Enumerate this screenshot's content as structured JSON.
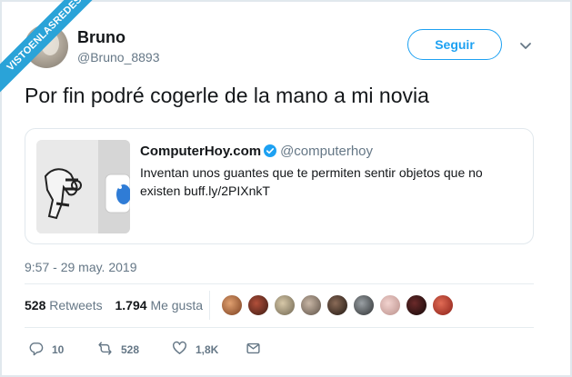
{
  "watermark": {
    "text": "VISTOENLASREDES"
  },
  "author": {
    "name": "Bruno",
    "handle": "@Bruno_8893"
  },
  "header": {
    "follow_label": "Seguir",
    "menu_icon": "chevron-down-icon"
  },
  "tweet": {
    "text": "Por fin podré cogerle de la mano a mi novia"
  },
  "quoted": {
    "source_name": "ComputerHoy.com",
    "source_handle": "@computerhoy",
    "text": "Inventan unos guantes que te permiten sentir objetos que no existen buff.ly/2PIXnkT"
  },
  "timestamp": "9:57 - 29 may. 2019",
  "stats": {
    "retweets_count": "528",
    "retweets_label": "Retweets",
    "likes_count": "1.794",
    "likes_label": "Me gusta"
  },
  "likers_count_shown": 9,
  "actions": {
    "replies": "10",
    "retweets": "528",
    "likes": "1,8K"
  },
  "colors": {
    "accent": "#1da1f2",
    "muted": "#657786",
    "watermark": "#2aa3d8",
    "verified": "#1da1f2"
  }
}
